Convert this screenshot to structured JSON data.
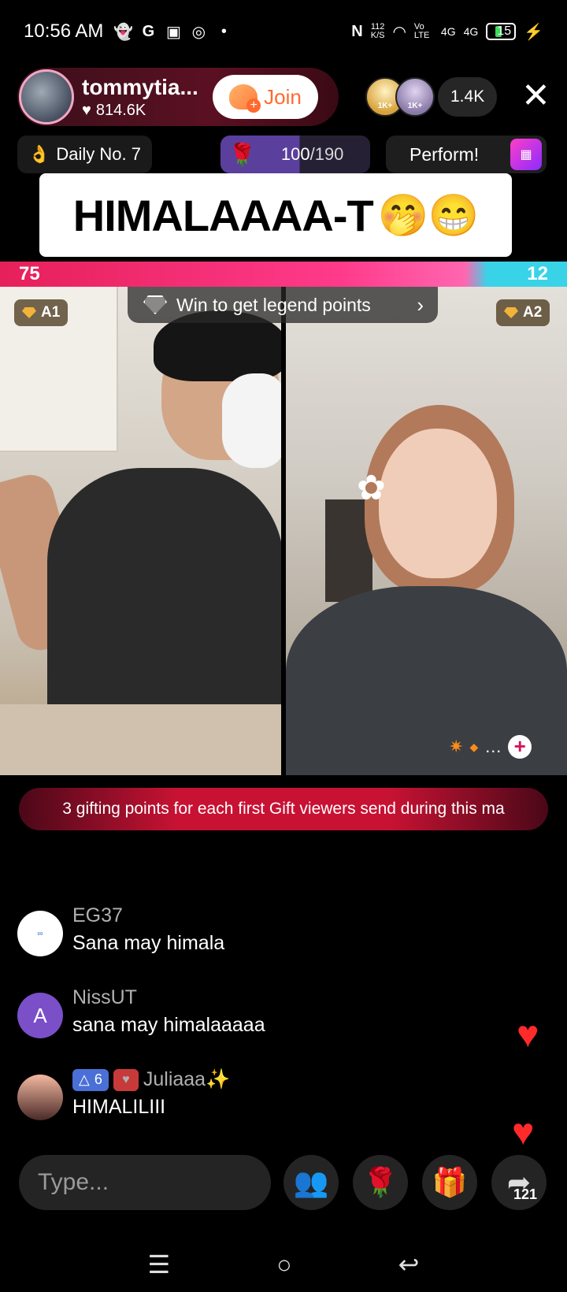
{
  "status_bar": {
    "time": "10:56 AM",
    "net_speed_value": "112",
    "net_speed_unit": "K/S",
    "battery": "15",
    "volte": "Vo LTE",
    "signal1": "4G",
    "signal2": "4G"
  },
  "host": {
    "name": "tommytia...",
    "likes": "814.6K",
    "join_label": "Join"
  },
  "viewers": {
    "badge1": "1K+",
    "badge2": "1K+",
    "count": "1.4K"
  },
  "subbar": {
    "daily": "Daily No. 7",
    "rose_current": "100",
    "rose_total": "/190",
    "rose_progress": 0.526,
    "perform": "Perform!"
  },
  "caption": {
    "text": "HIMALAAAA-T",
    "emoji": "🤭😁"
  },
  "battle": {
    "left_score": "75",
    "right_score": "12",
    "left_tag": "A1",
    "right_tag": "A2",
    "legend_text": "Win to get legend points"
  },
  "gift_banner": "3 gifting points for each first Gift viewers send during this ma",
  "chat": [
    {
      "user": "EG37",
      "text": "Sana may himala",
      "avatar": ""
    },
    {
      "user": "NissUT",
      "text": "sana may himalaaaaa",
      "avatar": "A"
    },
    {
      "user": "Juliaaa✨",
      "text": "HIMALILIII",
      "avatar": "",
      "level": "6"
    }
  ],
  "bottom": {
    "placeholder": "Type...",
    "share_count": "121"
  },
  "colors": {
    "score_left": "#e6205a",
    "score_right": "#39d3e8",
    "join_text": "#ff6a2e",
    "banner": "#c81233"
  }
}
